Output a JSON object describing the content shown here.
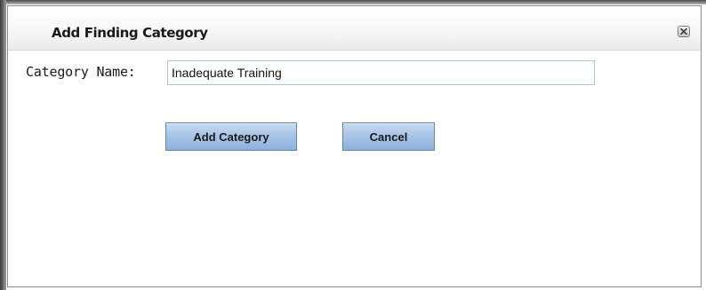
{
  "dialog": {
    "title": "Add Finding Category",
    "close_icon": "close-icon"
  },
  "form": {
    "category_label": "Category Name:",
    "category_value": "Inadequate Training"
  },
  "buttons": {
    "add_label": "Add Category",
    "cancel_label": "Cancel"
  },
  "colors": {
    "button_blue": "#a9c5e6",
    "button_border": "#5f86b3",
    "input_border": "#a9c4dc"
  }
}
